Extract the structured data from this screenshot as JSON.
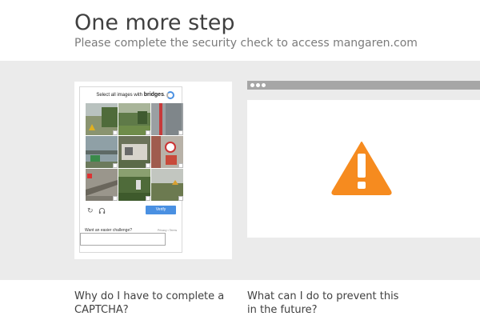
{
  "header": {
    "title": "One more step",
    "subtitle": "Please complete the security check to access mangaren.com"
  },
  "captcha": {
    "instruction_prefix": "Select all images with ",
    "instruction_target": "bridges",
    "instruction_suffix": ".",
    "verify_label": "Verify",
    "easier_label": "Want an easier challenge?",
    "privacy_label": "Privacy • Terms",
    "tiles": [
      {
        "bg": "#7a8b5e"
      },
      {
        "bg": "#5f7a48"
      },
      {
        "bg": "#8b8f92"
      },
      {
        "bg": "#8fa0a6"
      },
      {
        "bg": "#6b7259"
      },
      {
        "bg": "#a05c4e"
      },
      {
        "bg": "#8d8a80"
      },
      {
        "bg": "#4f6b3a"
      },
      {
        "bg": "#9ea39a"
      }
    ],
    "refresh_icon": "refresh-icon",
    "audio_icon": "headphones-icon"
  },
  "colors": {
    "warning": "#f68b1f",
    "verify": "#4a90e2",
    "band": "#ebebeb"
  },
  "questions": {
    "why": "Why do I have to complete a CAPTCHA?",
    "prevent": "What can I do to prevent this in the future?"
  }
}
